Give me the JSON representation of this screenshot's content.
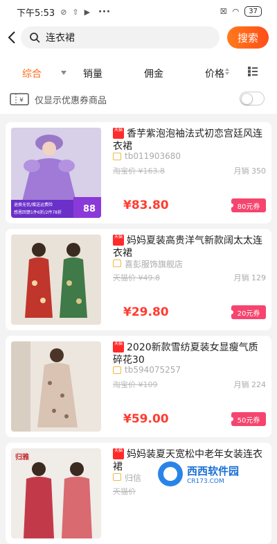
{
  "status_bar": {
    "time": "下午5:53",
    "battery": "37"
  },
  "search": {
    "query": "连衣裙",
    "button": "搜索"
  },
  "sort_tabs": [
    {
      "label": "综合"
    },
    {
      "label": "销量"
    },
    {
      "label": "佣金"
    },
    {
      "label": "价格"
    }
  ],
  "coupon_filter": {
    "label": "仅显示优惠券商品",
    "enabled": false
  },
  "colors": {
    "accent": "#ff6a1a",
    "price": "#ff3b30",
    "coupon": "#f5456e"
  },
  "products": [
    {
      "title": "香芋紫泡泡袖法式初恋宫廷风连衣裙",
      "shop": "tb011903680",
      "original": "淘宝价 ¥163.8",
      "sales": "月销 350",
      "price": "¥83.80",
      "coupon": "80元券",
      "thumb_text_1": "88",
      "thumb_text_2": "退换无忧/赠送运费险",
      "thumb_text_3": "感恩回馈1件6折/2件78折"
    },
    {
      "title": "妈妈夏装高贵洋气新款阔太太连衣裙",
      "shop": "喜彭服饰旗舰店",
      "original": "天猫价 ¥49.8",
      "sales": "月销 129",
      "price": "¥29.80",
      "coupon": "20元券"
    },
    {
      "title": "2020新款雪纺夏装女显瘦气质碎花30",
      "shop": "tb594075257",
      "original": "淘宝价 ¥109",
      "sales": "月销 224",
      "price": "¥59.00",
      "coupon": "50元券"
    },
    {
      "title": "妈妈装夏天宽松中老年女装连衣裙",
      "shop": "归信",
      "original": "天猫价",
      "sales": "",
      "price": "",
      "coupon": "",
      "thumb_text_1": "归雅"
    }
  ],
  "watermark": {
    "title": "西西软件园",
    "sub": "CR173.COM"
  }
}
